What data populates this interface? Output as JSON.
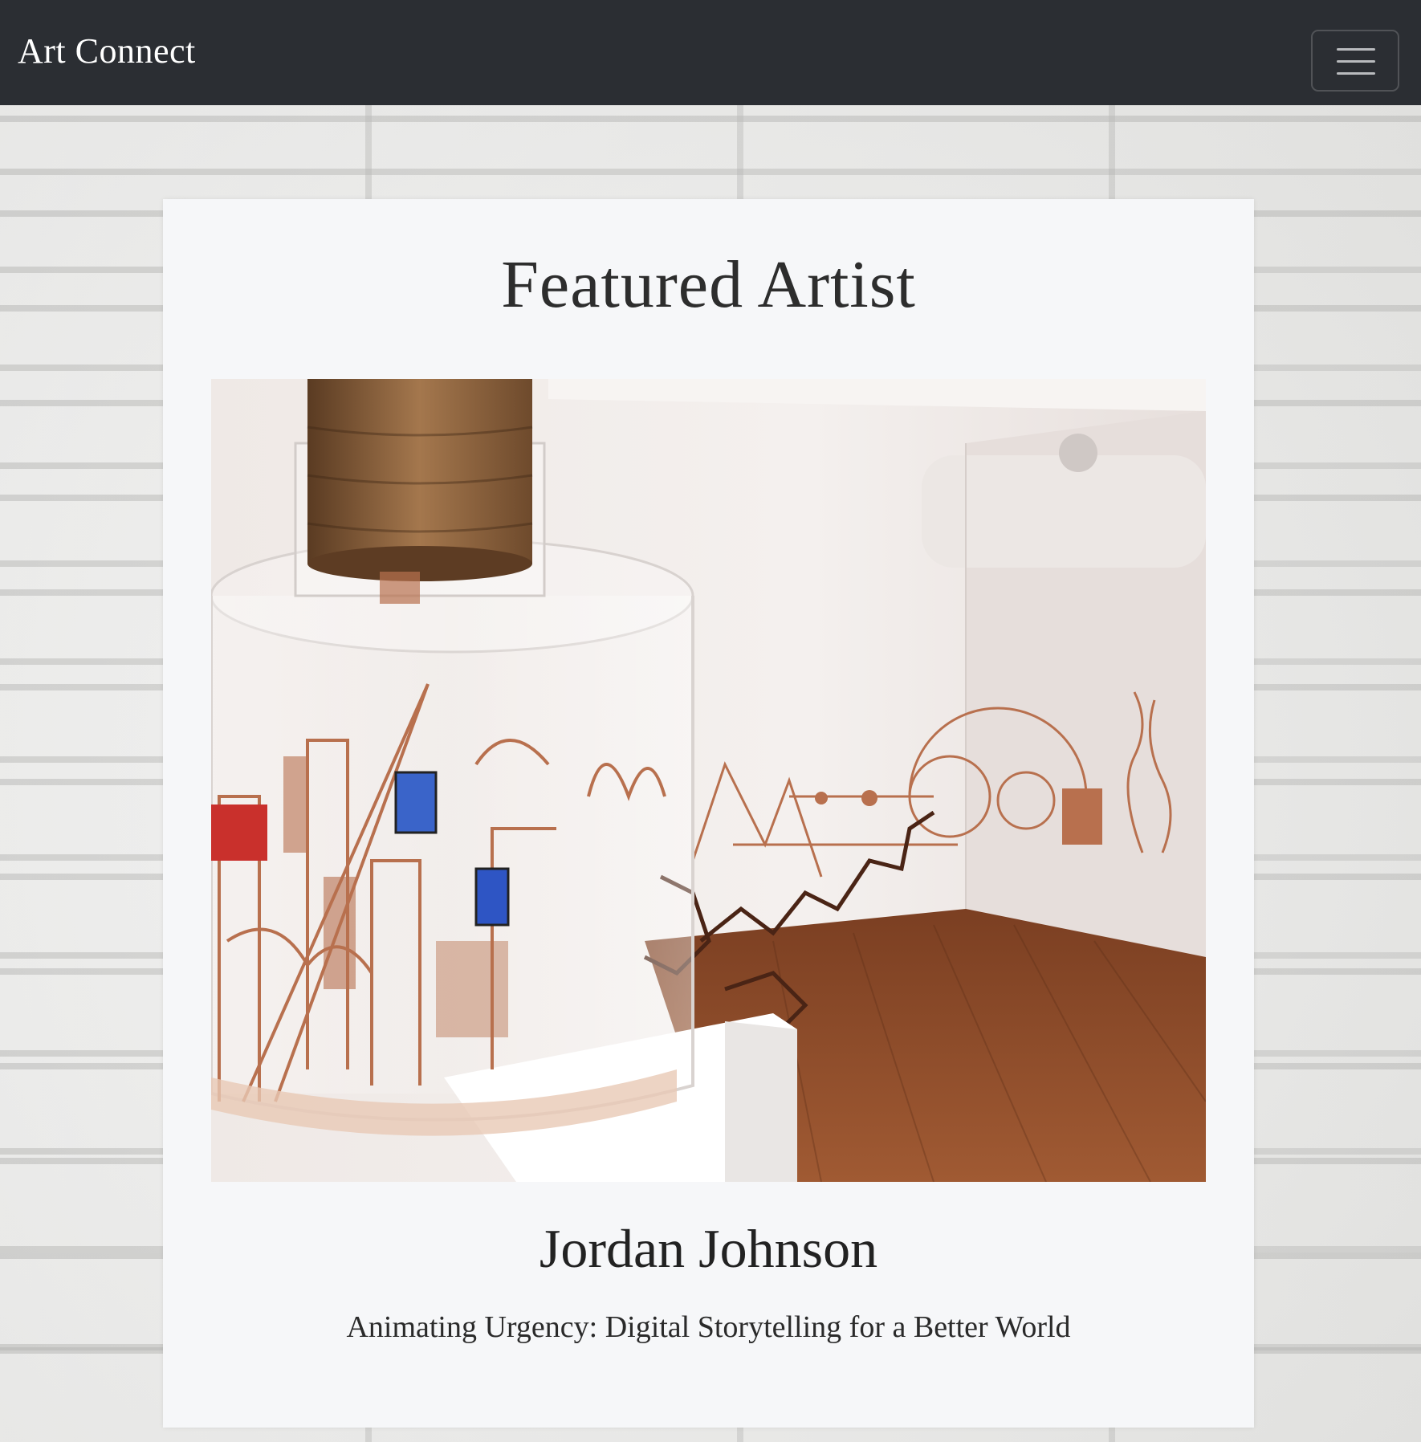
{
  "navbar": {
    "brand": "Art Connect",
    "menu_icon": "hamburger-menu-icon"
  },
  "featured": {
    "heading": "Featured Artist",
    "artist_name": "Jordan Johnson",
    "tagline": "Animating Urgency: Digital Storytelling for a Better World",
    "image_icon": "gallery-installation-image"
  },
  "colors": {
    "navbar_bg": "#2b2e33",
    "card_bg": "#f6f7f9",
    "heading_text": "#2d2d2d",
    "copper_accent": "#b8704e",
    "floor_wood": "#8a4a28"
  }
}
